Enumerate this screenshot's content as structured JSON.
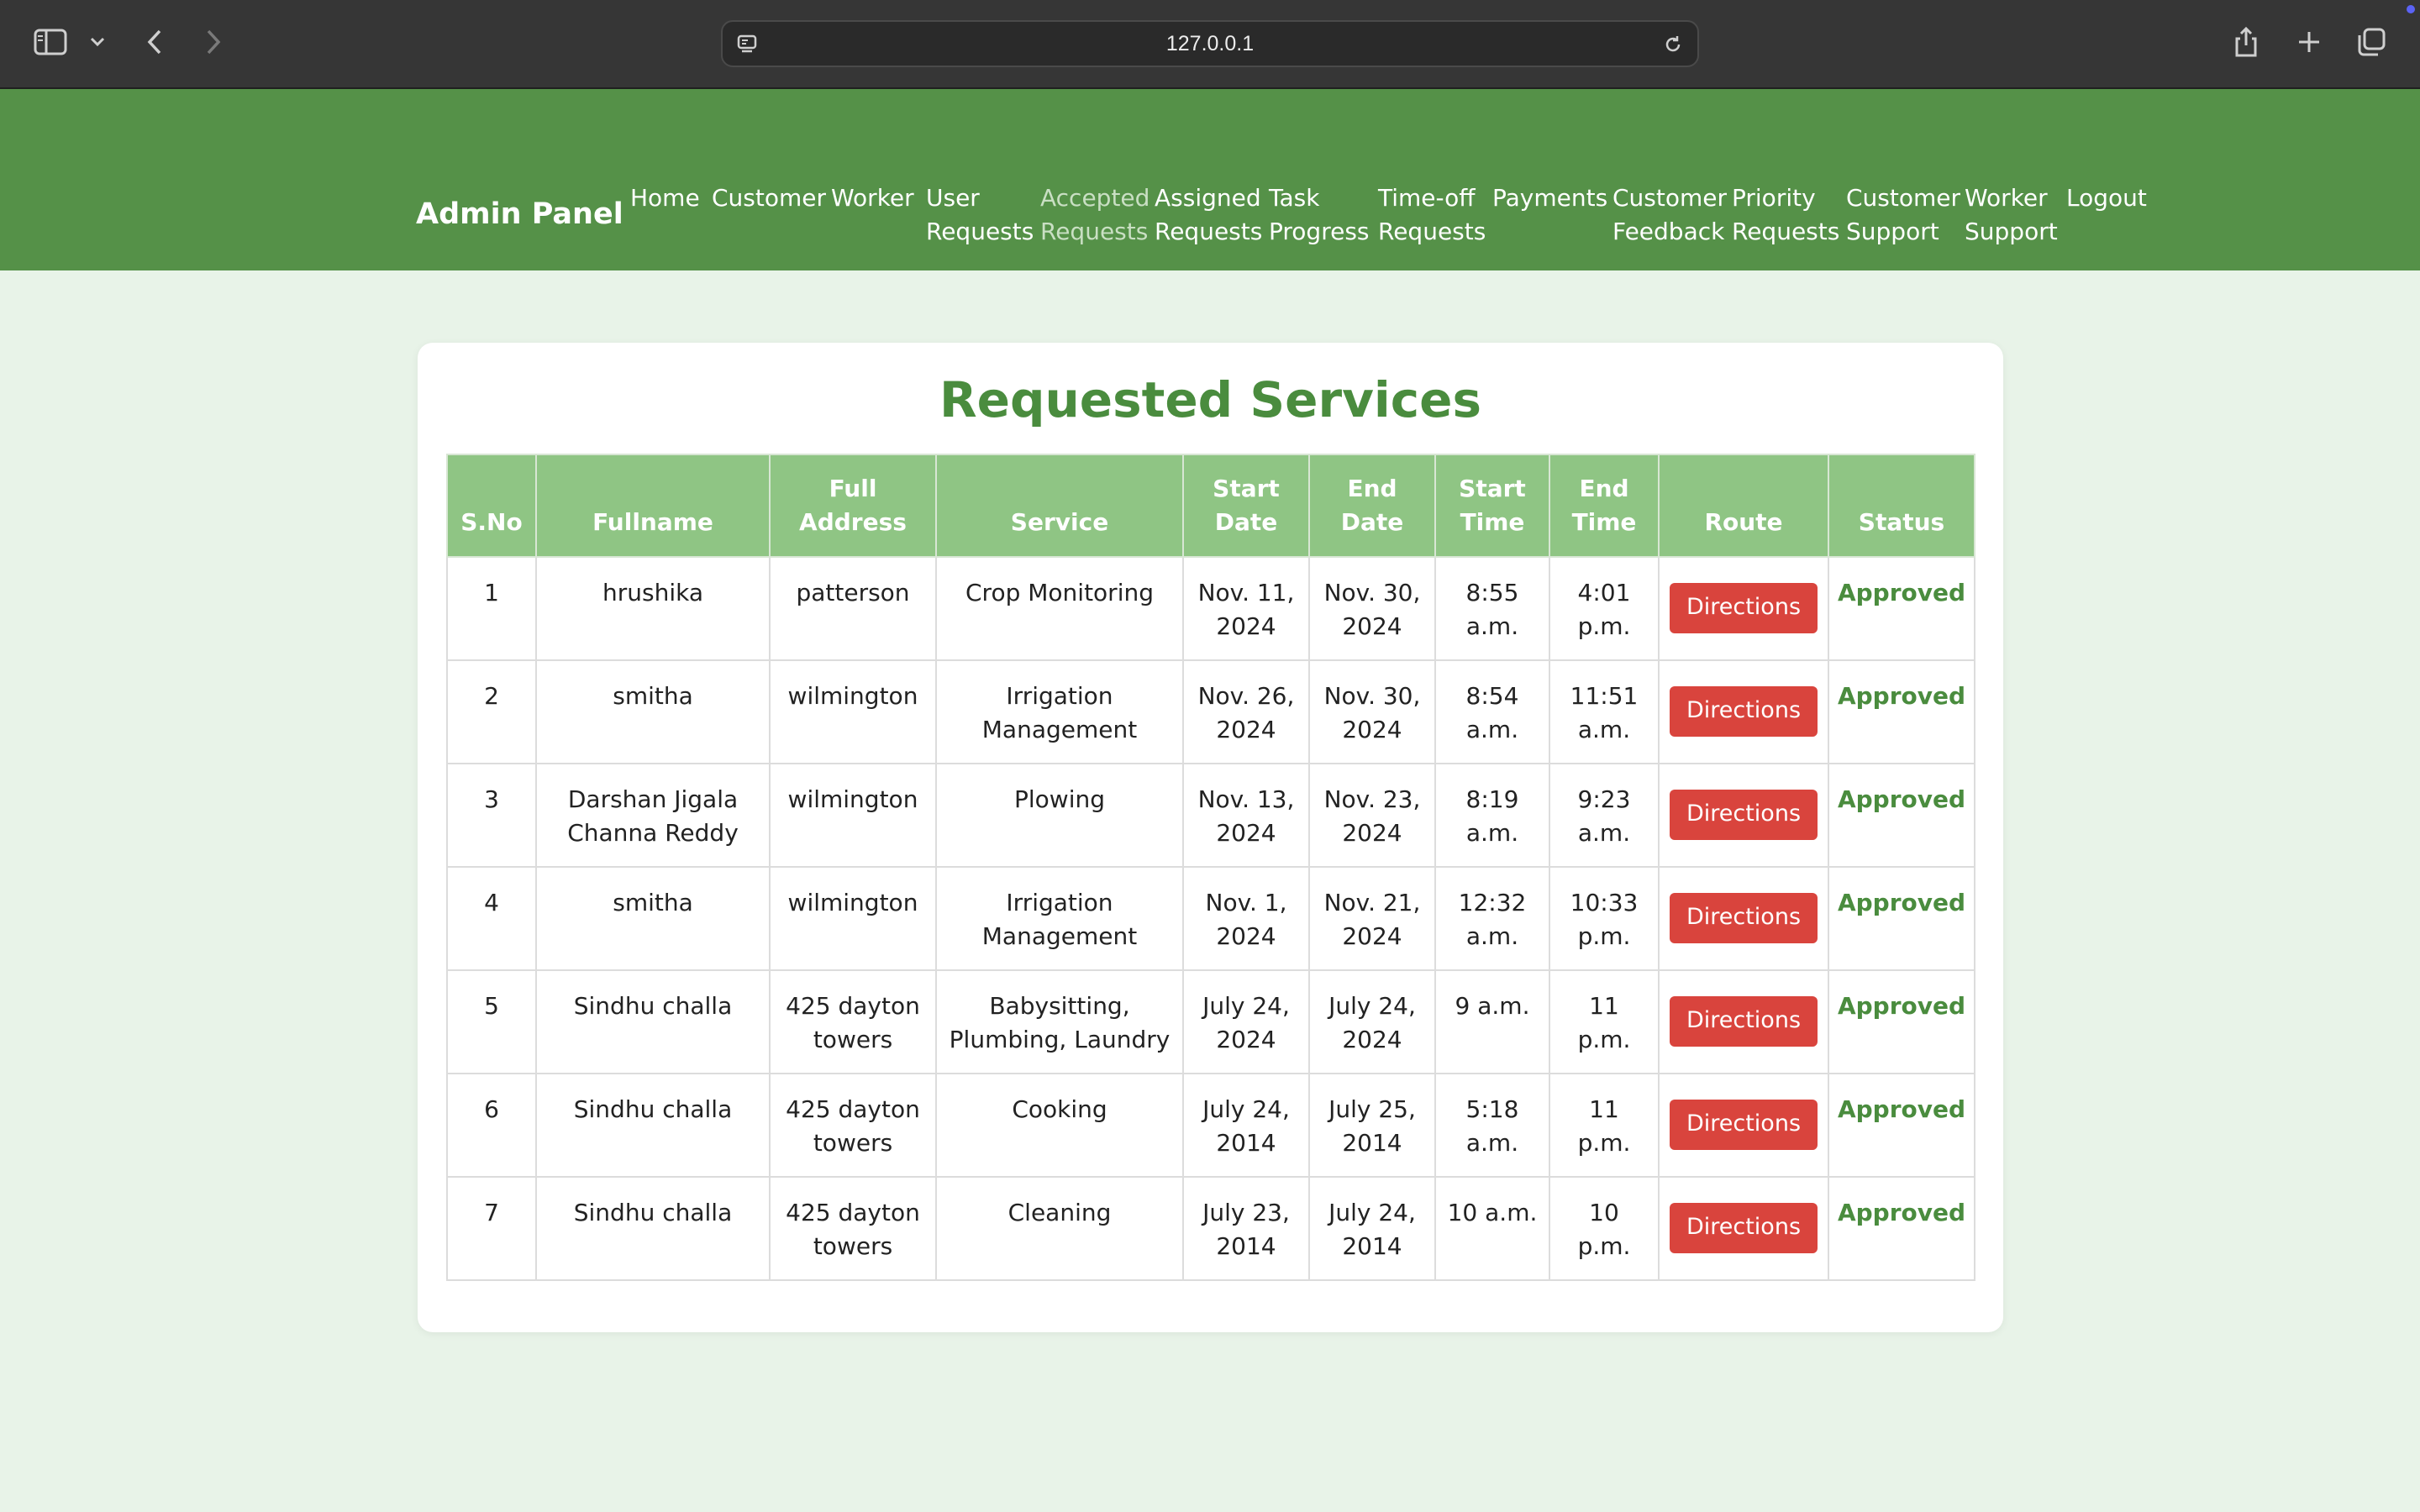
{
  "browser": {
    "url": "127.0.0.1"
  },
  "nav": {
    "brand": "Admin Panel",
    "items": [
      {
        "line1": "Home",
        "line2": ""
      },
      {
        "line1": "Customer",
        "line2": ""
      },
      {
        "line1": "Worker",
        "line2": ""
      },
      {
        "line1": "User",
        "line2": "Requests"
      },
      {
        "line1": "Accepted",
        "line2": "Requests"
      },
      {
        "line1": "Assigned",
        "line2": "Requests"
      },
      {
        "line1": "Task",
        "line2": "Progress"
      },
      {
        "line1": "Time-off",
        "line2": "Requests"
      },
      {
        "line1": "Payments",
        "line2": ""
      },
      {
        "line1": "Customer",
        "line2": "Feedback"
      },
      {
        "line1": "Priority",
        "line2": "Requests"
      },
      {
        "line1": "Customer",
        "line2": "Support"
      },
      {
        "line1": "Worker",
        "line2": "Support"
      },
      {
        "line1": "Logout",
        "line2": ""
      }
    ]
  },
  "page": {
    "title": "Requested Services"
  },
  "table": {
    "headers": [
      {
        "line1": "S.No",
        "line2": ""
      },
      {
        "line1": "Fullname",
        "line2": ""
      },
      {
        "line1": "Full",
        "line2": "Address"
      },
      {
        "line1": "Service",
        "line2": ""
      },
      {
        "line1": "Start",
        "line2": "Date"
      },
      {
        "line1": "End",
        "line2": "Date"
      },
      {
        "line1": "Start",
        "line2": "Time"
      },
      {
        "line1": "End",
        "line2": "Time"
      },
      {
        "line1": "Route",
        "line2": ""
      },
      {
        "line1": "Status",
        "line2": ""
      }
    ],
    "rows": [
      {
        "sno": "1",
        "name": [
          "hrushika"
        ],
        "address": [
          "patterson"
        ],
        "service": [
          "Crop Monitoring"
        ],
        "start_date": [
          "Nov. 11,",
          "2024"
        ],
        "end_date": [
          "Nov. 30,",
          "2024"
        ],
        "start_time": [
          "8:55",
          "a.m."
        ],
        "end_time": [
          "4:01",
          "p.m."
        ],
        "route": "Directions",
        "status": "Approved"
      },
      {
        "sno": "2",
        "name": [
          "smitha"
        ],
        "address": [
          "wilmington"
        ],
        "service": [
          "Irrigation",
          "Management"
        ],
        "start_date": [
          "Nov. 26,",
          "2024"
        ],
        "end_date": [
          "Nov. 30,",
          "2024"
        ],
        "start_time": [
          "8:54",
          "a.m."
        ],
        "end_time": [
          "11:51",
          "a.m."
        ],
        "route": "Directions",
        "status": "Approved"
      },
      {
        "sno": "3",
        "name": [
          "Darshan Jigala",
          "Channa Reddy"
        ],
        "address": [
          "wilmington"
        ],
        "service": [
          "Plowing"
        ],
        "start_date": [
          "Nov. 13,",
          "2024"
        ],
        "end_date": [
          "Nov. 23,",
          "2024"
        ],
        "start_time": [
          "8:19",
          "a.m."
        ],
        "end_time": [
          "9:23",
          "a.m."
        ],
        "route": "Directions",
        "status": "Approved"
      },
      {
        "sno": "4",
        "name": [
          "smitha"
        ],
        "address": [
          "wilmington"
        ],
        "service": [
          "Irrigation",
          "Management"
        ],
        "start_date": [
          "Nov. 1,",
          "2024"
        ],
        "end_date": [
          "Nov. 21,",
          "2024"
        ],
        "start_time": [
          "12:32",
          "a.m."
        ],
        "end_time": [
          "10:33",
          "p.m."
        ],
        "route": "Directions",
        "status": "Approved"
      },
      {
        "sno": "5",
        "name": [
          "Sindhu challa"
        ],
        "address": [
          "425 dayton",
          "towers"
        ],
        "service": [
          "Babysitting,",
          "Plumbing, Laundry"
        ],
        "start_date": [
          "July 24,",
          "2024"
        ],
        "end_date": [
          "July 24,",
          "2024"
        ],
        "start_time": [
          "9 a.m."
        ],
        "end_time": [
          "11",
          "p.m."
        ],
        "route": "Directions",
        "status": "Approved"
      },
      {
        "sno": "6",
        "name": [
          "Sindhu challa"
        ],
        "address": [
          "425 dayton",
          "towers"
        ],
        "service": [
          "Cooking"
        ],
        "start_date": [
          "July 24,",
          "2014"
        ],
        "end_date": [
          "July 25,",
          "2014"
        ],
        "start_time": [
          "5:18",
          "a.m."
        ],
        "end_time": [
          "11",
          "p.m."
        ],
        "route": "Directions",
        "status": "Approved"
      },
      {
        "sno": "7",
        "name": [
          "Sindhu challa"
        ],
        "address": [
          "425 dayton",
          "towers"
        ],
        "service": [
          "Cleaning"
        ],
        "start_date": [
          "July 23,",
          "2014"
        ],
        "end_date": [
          "July 24,",
          "2014"
        ],
        "start_time": [
          "10 a.m."
        ],
        "end_time": [
          "10",
          "p.m."
        ],
        "route": "Directions",
        "status": "Approved"
      }
    ]
  },
  "colors": {
    "nav_bg": "#559148",
    "page_bg": "#e8f3e8",
    "header_bg": "#8fc584",
    "accent_green": "#4a8c3e",
    "button_red": "#d9443d",
    "active_nav_text": "#c9dfc3"
  },
  "icons": {
    "sidebar": "sidebar-toggle-icon",
    "chevron": "chevron-down-icon",
    "back": "back-arrow-icon",
    "forward": "forward-arrow-icon",
    "site": "site-info-icon",
    "reload": "reload-icon",
    "share": "share-icon",
    "new_tab": "plus-icon",
    "tabs": "tab-overview-icon"
  }
}
